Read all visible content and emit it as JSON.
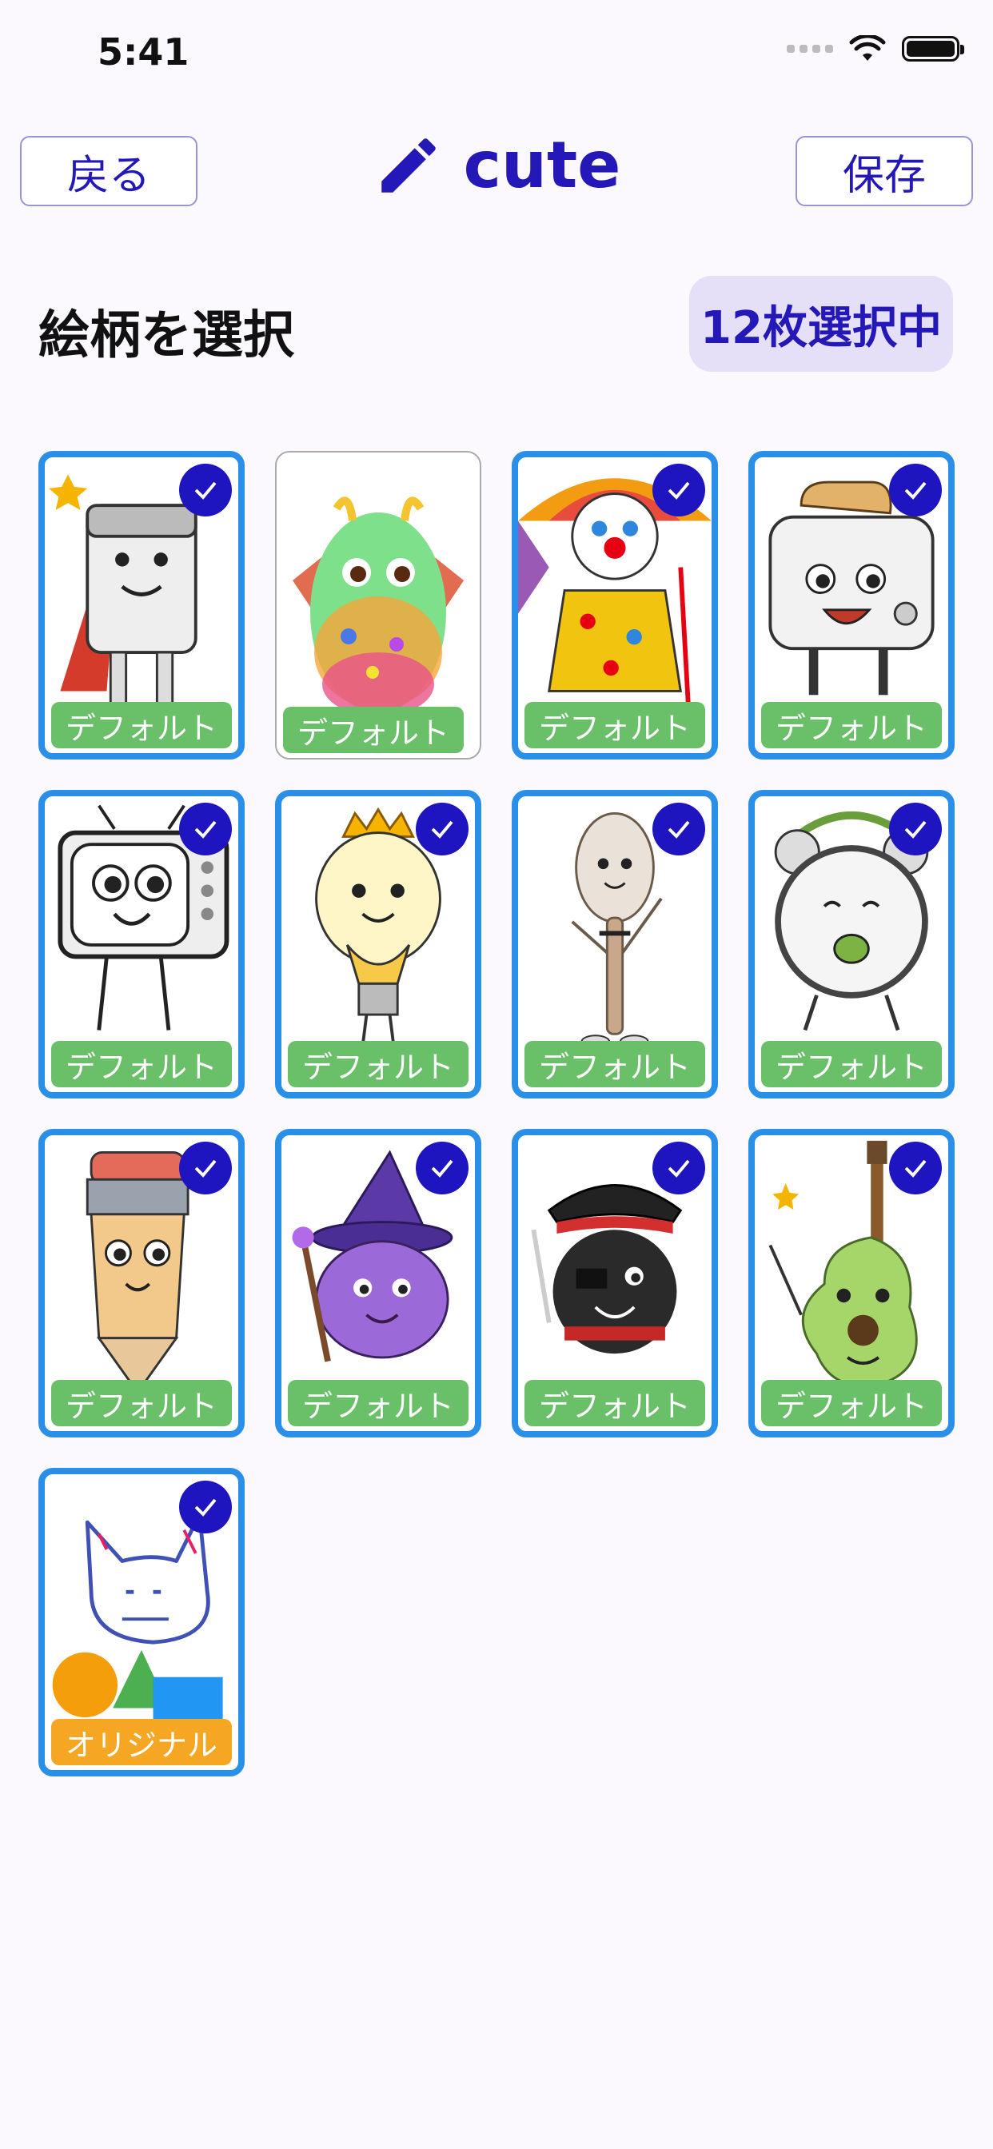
{
  "status": {
    "time": "5:41"
  },
  "header": {
    "back_label": "戻る",
    "title": "cute",
    "save_label": "保存"
  },
  "section": {
    "title": "絵柄を選択",
    "count": "12枚選択中"
  },
  "cards": [
    {
      "subject": "superhero eraser",
      "tag": "デフォルト",
      "tag_type": "default",
      "selected": true
    },
    {
      "subject": "rainbow egg dragon",
      "tag": "デフォルト",
      "tag_type": "default",
      "selected": false
    },
    {
      "subject": "clown with umbrella",
      "tag": "デフォルト",
      "tag_type": "default",
      "selected": true
    },
    {
      "subject": "toaster",
      "tag": "デフォルト",
      "tag_type": "default",
      "selected": true
    },
    {
      "subject": "retro tv",
      "tag": "デフォルト",
      "tag_type": "default",
      "selected": true
    },
    {
      "subject": "light bulb with crown",
      "tag": "デフォルト",
      "tag_type": "default",
      "selected": true
    },
    {
      "subject": "spoon",
      "tag": "デフォルト",
      "tag_type": "default",
      "selected": true
    },
    {
      "subject": "alarm clock",
      "tag": "デフォルト",
      "tag_type": "default",
      "selected": true
    },
    {
      "subject": "pencil",
      "tag": "デフォルト",
      "tag_type": "default",
      "selected": true
    },
    {
      "subject": "wizard blob",
      "tag": "デフォルト",
      "tag_type": "default",
      "selected": true
    },
    {
      "subject": "pirate blob",
      "tag": "デフォルト",
      "tag_type": "default",
      "selected": true
    },
    {
      "subject": "guitar",
      "tag": "デフォルト",
      "tag_type": "default",
      "selected": true
    },
    {
      "subject": "cat drawing with shapes",
      "tag": "オリジナル",
      "tag_type": "original",
      "selected": true
    }
  ],
  "colors": {
    "accent": "#2418b8",
    "selected_border": "#2a8fe8",
    "default_tag": "#6abf69",
    "original_tag": "#f5a623",
    "badge_bg": "#e5e0f7"
  }
}
